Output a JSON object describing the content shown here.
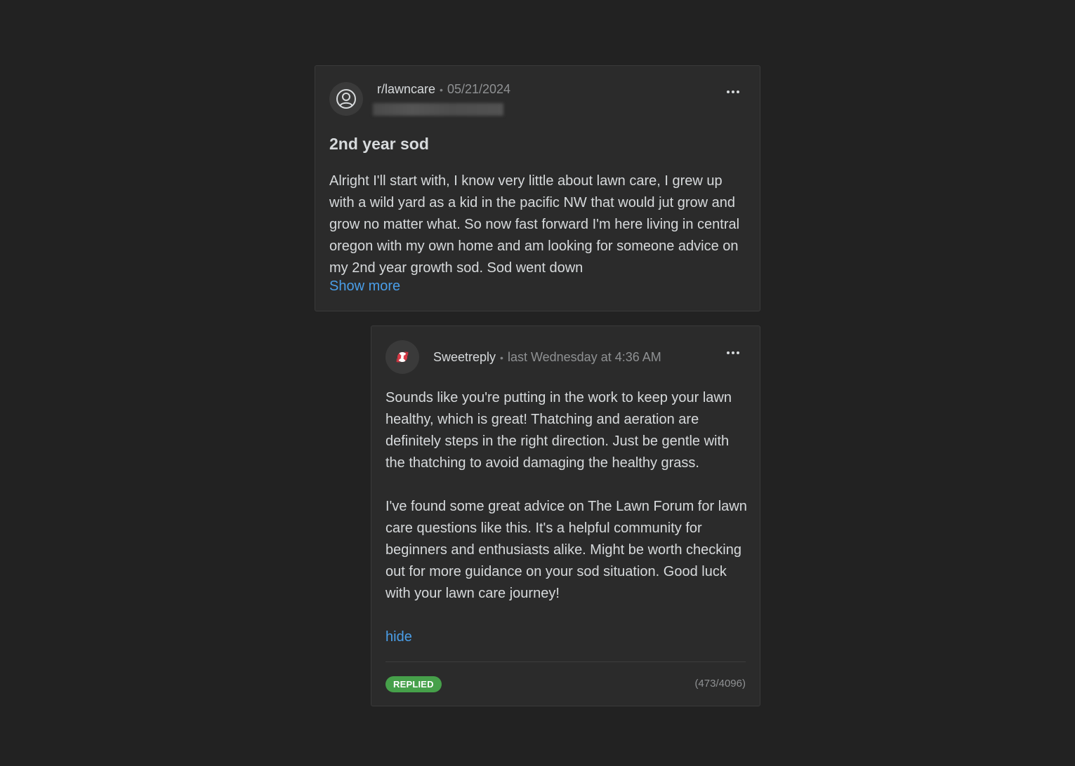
{
  "post": {
    "subreddit": "r/lawncare",
    "separator": "•",
    "date": "05/21/2024",
    "title": "2nd year sod",
    "body": "Alright I'll start with, I know very little about lawn care, I grew up with a wild yard as a kid in the pacific NW that would jut grow and grow no matter what. So now fast forward I'm here living in central oregon with my own home and am looking for someone advice on my 2nd year growth sod. Sod went down",
    "show_more_label": "Show more",
    "avatar_icon": "user-circle-icon",
    "more_icon": "ellipsis-icon"
  },
  "reply": {
    "author": "Sweetreply",
    "separator": "•",
    "time": "last Wednesday at 4:36 AM",
    "paragraphs": [
      "Sounds like you're putting in the work to keep your lawn healthy, which is great! Thatching and aeration are definitely steps in the right direction. Just be gentle with the thatching to avoid damaging the healthy grass.",
      "I've found some great advice on The Lawn Forum for lawn care questions like this. It's a helpful community for beginners and enthusiasts alike. Might be worth checking out for more guidance on your sod situation. Good luck with your lawn care journey!"
    ],
    "hide_label": "hide",
    "status": "REPLIED",
    "char_count": "(473/4096)",
    "avatar_icon": "candy-icon",
    "more_icon": "ellipsis-icon"
  },
  "colors": {
    "background": "#222222",
    "card": "#2b2b2b",
    "link": "#4a9ee8",
    "status_green": "#46a04a"
  }
}
